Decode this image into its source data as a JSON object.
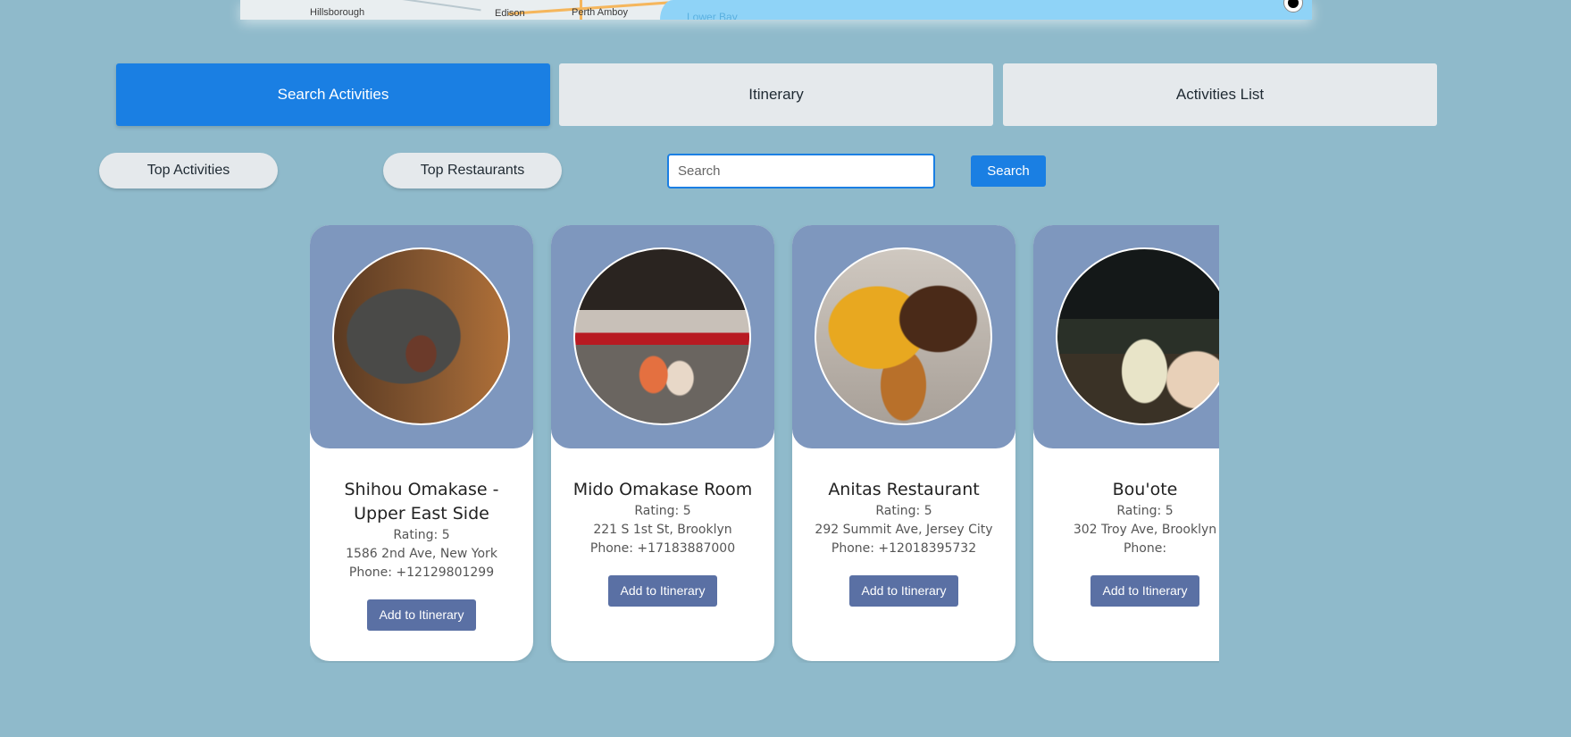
{
  "map": {
    "labels": [
      "Edison",
      "Perth Amboy",
      "Hillsborough",
      "Lower Bay"
    ]
  },
  "tabs": [
    {
      "label": "Search Activities",
      "active": true
    },
    {
      "label": "Itinerary",
      "active": false
    },
    {
      "label": "Activities List",
      "active": false
    }
  ],
  "filters": {
    "top_activities": "Top Activities",
    "top_restaurants": "Top Restaurants",
    "search_placeholder": "Search",
    "search_value": "",
    "search_button": "Search"
  },
  "cards": [
    {
      "name": "Shihou Omakase - Upper East Side",
      "rating": "Rating: 5",
      "address": "1586 2nd Ave, New York",
      "phone": "Phone: +12129801299",
      "button": "Add to Itinerary"
    },
    {
      "name": "Mido Omakase Room",
      "rating": "Rating: 5",
      "address": "221 S 1st St, Brooklyn",
      "phone": "Phone: +17183887000",
      "button": "Add to Itinerary"
    },
    {
      "name": "Anitas Restaurant",
      "rating": "Rating: 5",
      "address": "292 Summit Ave, Jersey City",
      "phone": "Phone: +12018395732",
      "button": "Add to Itinerary"
    },
    {
      "name": "Bou'ote",
      "rating": "Rating: 5",
      "address": "302 Troy Ave, Brooklyn",
      "phone": "Phone:",
      "button": "Add to Itinerary"
    }
  ],
  "colors": {
    "background": "#8fbacb",
    "accent": "#1a7fe3",
    "card_header": "#7e97be",
    "card_button": "#5a70a4"
  }
}
